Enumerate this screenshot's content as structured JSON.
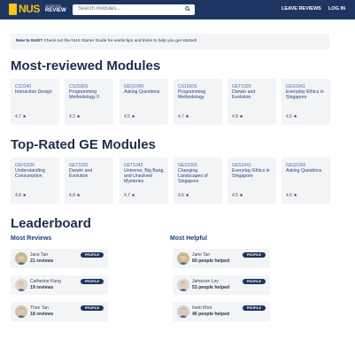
{
  "nav": {
    "logo_text": "NUS",
    "logo_sub1": "NUSMODS",
    "logo_sub2": "REVIEW",
    "search_placeholder": "Search modules...",
    "leave_reviews": "LEAVE REVIEWS",
    "login": "LOG IN"
  },
  "banner": {
    "bold": "New to NUS?",
    "text": " Check out the NUS Starter Guide for useful tips and tricks to help you get started!"
  },
  "most_reviewed": {
    "title": "Most-reviewed Modules",
    "cards": [
      {
        "code": "CS3240",
        "name": "Interaction Design",
        "rating": "4.7"
      },
      {
        "code": "CS2030S",
        "name": "Programming Methodology II",
        "rating": "4.2"
      },
      {
        "code": "GEQ1000",
        "name": "Asking Questions",
        "rating": "4.5"
      },
      {
        "code": "CS1010S",
        "name": "Programming Methodology",
        "rating": "4.7"
      },
      {
        "code": "GET1020",
        "name": "Darwin and Evolution",
        "rating": "4.8"
      },
      {
        "code": "GES1041",
        "name": "Everyday Ethics in Singapore",
        "rating": "4.5"
      }
    ]
  },
  "top_rated": {
    "title": "Top-Rated GE Modules",
    "cards": [
      {
        "code": "GEH1036",
        "name": "Understanding Consumption",
        "rating": "4.8"
      },
      {
        "code": "GET1020",
        "name": "Darwin and Evolution",
        "rating": "4.8"
      },
      {
        "code": "GET1043",
        "name": "Universe, Big Bang, and Unsolved Mysteries",
        "rating": "4.7"
      },
      {
        "code": "GES1003",
        "name": "Changing Landscapes of Singapore",
        "rating": "4.6"
      },
      {
        "code": "GES1041",
        "name": "Everyday Ethics in Singapore",
        "rating": "4.5"
      },
      {
        "code": "GEQ1000",
        "name": "Asking Questions",
        "rating": "4.5"
      }
    ]
  },
  "leaderboard": {
    "title": "Leaderboard",
    "most_reviews": {
      "title": "Most Reviews",
      "entries": [
        {
          "name": "Jane Tan",
          "count": "21 reviews",
          "button": "PROFILE"
        },
        {
          "name": "Catherine Kang",
          "count": "19 reviews",
          "button": "PROFILE"
        },
        {
          "name": "Theo Tan",
          "count": "18 reviews",
          "button": "PROFILE"
        }
      ]
    },
    "most_helpful": {
      "title": "Most Helpful",
      "entries": [
        {
          "name": "Jane Tan",
          "count": "60 people helped",
          "button": "PROFILE"
        },
        {
          "name": "Jameson Loy",
          "count": "53 people helped",
          "button": "PROFILE"
        },
        {
          "name": "Irwin Khor",
          "count": "46 people helped",
          "button": "PROFILE"
        }
      ]
    }
  },
  "colors": {
    "nav_bg": "#1d3560",
    "accent": "#f5c518",
    "card_bg": "#f3f4f6",
    "text_dark": "#1f2d4d"
  },
  "icons": {
    "search": "search-icon",
    "star": "star-icon"
  }
}
